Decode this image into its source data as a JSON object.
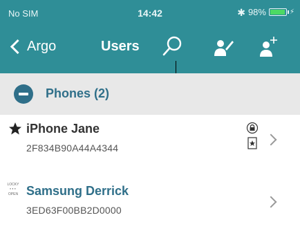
{
  "status": {
    "carrier": "No SIM",
    "time": "14:42",
    "battery": "98%",
    "battery_fraction": 0.98,
    "battery_color": "#4cd964"
  },
  "nav": {
    "back_label": "Argo",
    "title": "Users",
    "icons": [
      "search-icon",
      "edit-user-icon",
      "add-user-icon"
    ]
  },
  "section": {
    "title": "Phones (2)",
    "icon": "minus-circle-icon"
  },
  "rows": [
    {
      "name": "iPhone Jane",
      "id": "2F834B90A44A4344",
      "lead_icon": "star-icon",
      "badges": [
        "lock-icon",
        "star-card-icon"
      ]
    },
    {
      "name": "Samsung Derrick",
      "id": "3ED63F00BB2D0000",
      "lead_icon": "dots-icon",
      "lead_text": [
        "LOCKY",
        "OPEN"
      ]
    }
  ],
  "colors": {
    "bar": "#2f8e97",
    "accent": "#2f6f89",
    "section_bg": "#e8e8e8"
  }
}
